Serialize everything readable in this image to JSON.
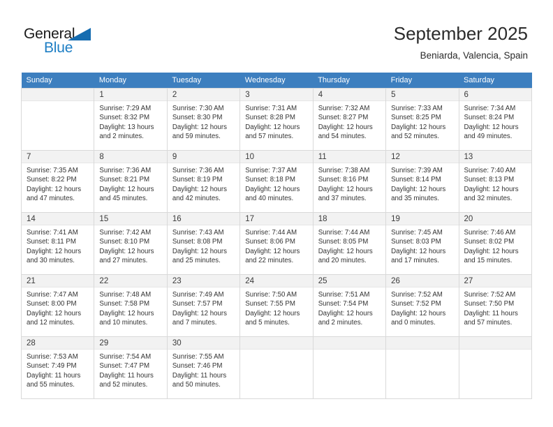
{
  "brand": {
    "name_part1": "General",
    "name_part2": "Blue",
    "accent_color": "#1d7ec4",
    "triangle_color": "#156cb0"
  },
  "header": {
    "title": "September 2025",
    "subtitle": "Beniarda, Valencia, Spain"
  },
  "calendar": {
    "header_bg": "#3d7fbf",
    "daynum_bg": "#f2f2f2",
    "weekday_labels": [
      "Sunday",
      "Monday",
      "Tuesday",
      "Wednesday",
      "Thursday",
      "Friday",
      "Saturday"
    ],
    "weeks": [
      [
        {
          "day": "",
          "lines": []
        },
        {
          "day": "1",
          "lines": [
            "Sunrise: 7:29 AM",
            "Sunset: 8:32 PM",
            "Daylight: 13 hours",
            "and 2 minutes."
          ]
        },
        {
          "day": "2",
          "lines": [
            "Sunrise: 7:30 AM",
            "Sunset: 8:30 PM",
            "Daylight: 12 hours",
            "and 59 minutes."
          ]
        },
        {
          "day": "3",
          "lines": [
            "Sunrise: 7:31 AM",
            "Sunset: 8:28 PM",
            "Daylight: 12 hours",
            "and 57 minutes."
          ]
        },
        {
          "day": "4",
          "lines": [
            "Sunrise: 7:32 AM",
            "Sunset: 8:27 PM",
            "Daylight: 12 hours",
            "and 54 minutes."
          ]
        },
        {
          "day": "5",
          "lines": [
            "Sunrise: 7:33 AM",
            "Sunset: 8:25 PM",
            "Daylight: 12 hours",
            "and 52 minutes."
          ]
        },
        {
          "day": "6",
          "lines": [
            "Sunrise: 7:34 AM",
            "Sunset: 8:24 PM",
            "Daylight: 12 hours",
            "and 49 minutes."
          ]
        }
      ],
      [
        {
          "day": "7",
          "lines": [
            "Sunrise: 7:35 AM",
            "Sunset: 8:22 PM",
            "Daylight: 12 hours",
            "and 47 minutes."
          ]
        },
        {
          "day": "8",
          "lines": [
            "Sunrise: 7:36 AM",
            "Sunset: 8:21 PM",
            "Daylight: 12 hours",
            "and 45 minutes."
          ]
        },
        {
          "day": "9",
          "lines": [
            "Sunrise: 7:36 AM",
            "Sunset: 8:19 PM",
            "Daylight: 12 hours",
            "and 42 minutes."
          ]
        },
        {
          "day": "10",
          "lines": [
            "Sunrise: 7:37 AM",
            "Sunset: 8:18 PM",
            "Daylight: 12 hours",
            "and 40 minutes."
          ]
        },
        {
          "day": "11",
          "lines": [
            "Sunrise: 7:38 AM",
            "Sunset: 8:16 PM",
            "Daylight: 12 hours",
            "and 37 minutes."
          ]
        },
        {
          "day": "12",
          "lines": [
            "Sunrise: 7:39 AM",
            "Sunset: 8:14 PM",
            "Daylight: 12 hours",
            "and 35 minutes."
          ]
        },
        {
          "day": "13",
          "lines": [
            "Sunrise: 7:40 AM",
            "Sunset: 8:13 PM",
            "Daylight: 12 hours",
            "and 32 minutes."
          ]
        }
      ],
      [
        {
          "day": "14",
          "lines": [
            "Sunrise: 7:41 AM",
            "Sunset: 8:11 PM",
            "Daylight: 12 hours",
            "and 30 minutes."
          ]
        },
        {
          "day": "15",
          "lines": [
            "Sunrise: 7:42 AM",
            "Sunset: 8:10 PM",
            "Daylight: 12 hours",
            "and 27 minutes."
          ]
        },
        {
          "day": "16",
          "lines": [
            "Sunrise: 7:43 AM",
            "Sunset: 8:08 PM",
            "Daylight: 12 hours",
            "and 25 minutes."
          ]
        },
        {
          "day": "17",
          "lines": [
            "Sunrise: 7:44 AM",
            "Sunset: 8:06 PM",
            "Daylight: 12 hours",
            "and 22 minutes."
          ]
        },
        {
          "day": "18",
          "lines": [
            "Sunrise: 7:44 AM",
            "Sunset: 8:05 PM",
            "Daylight: 12 hours",
            "and 20 minutes."
          ]
        },
        {
          "day": "19",
          "lines": [
            "Sunrise: 7:45 AM",
            "Sunset: 8:03 PM",
            "Daylight: 12 hours",
            "and 17 minutes."
          ]
        },
        {
          "day": "20",
          "lines": [
            "Sunrise: 7:46 AM",
            "Sunset: 8:02 PM",
            "Daylight: 12 hours",
            "and 15 minutes."
          ]
        }
      ],
      [
        {
          "day": "21",
          "lines": [
            "Sunrise: 7:47 AM",
            "Sunset: 8:00 PM",
            "Daylight: 12 hours",
            "and 12 minutes."
          ]
        },
        {
          "day": "22",
          "lines": [
            "Sunrise: 7:48 AM",
            "Sunset: 7:58 PM",
            "Daylight: 12 hours",
            "and 10 minutes."
          ]
        },
        {
          "day": "23",
          "lines": [
            "Sunrise: 7:49 AM",
            "Sunset: 7:57 PM",
            "Daylight: 12 hours",
            "and 7 minutes."
          ]
        },
        {
          "day": "24",
          "lines": [
            "Sunrise: 7:50 AM",
            "Sunset: 7:55 PM",
            "Daylight: 12 hours",
            "and 5 minutes."
          ]
        },
        {
          "day": "25",
          "lines": [
            "Sunrise: 7:51 AM",
            "Sunset: 7:54 PM",
            "Daylight: 12 hours",
            "and 2 minutes."
          ]
        },
        {
          "day": "26",
          "lines": [
            "Sunrise: 7:52 AM",
            "Sunset: 7:52 PM",
            "Daylight: 12 hours",
            "and 0 minutes."
          ]
        },
        {
          "day": "27",
          "lines": [
            "Sunrise: 7:52 AM",
            "Sunset: 7:50 PM",
            "Daylight: 11 hours",
            "and 57 minutes."
          ]
        }
      ],
      [
        {
          "day": "28",
          "lines": [
            "Sunrise: 7:53 AM",
            "Sunset: 7:49 PM",
            "Daylight: 11 hours",
            "and 55 minutes."
          ]
        },
        {
          "day": "29",
          "lines": [
            "Sunrise: 7:54 AM",
            "Sunset: 7:47 PM",
            "Daylight: 11 hours",
            "and 52 minutes."
          ]
        },
        {
          "day": "30",
          "lines": [
            "Sunrise: 7:55 AM",
            "Sunset: 7:46 PM",
            "Daylight: 11 hours",
            "and 50 minutes."
          ]
        },
        {
          "day": "",
          "lines": []
        },
        {
          "day": "",
          "lines": []
        },
        {
          "day": "",
          "lines": []
        },
        {
          "day": "",
          "lines": []
        }
      ]
    ]
  }
}
